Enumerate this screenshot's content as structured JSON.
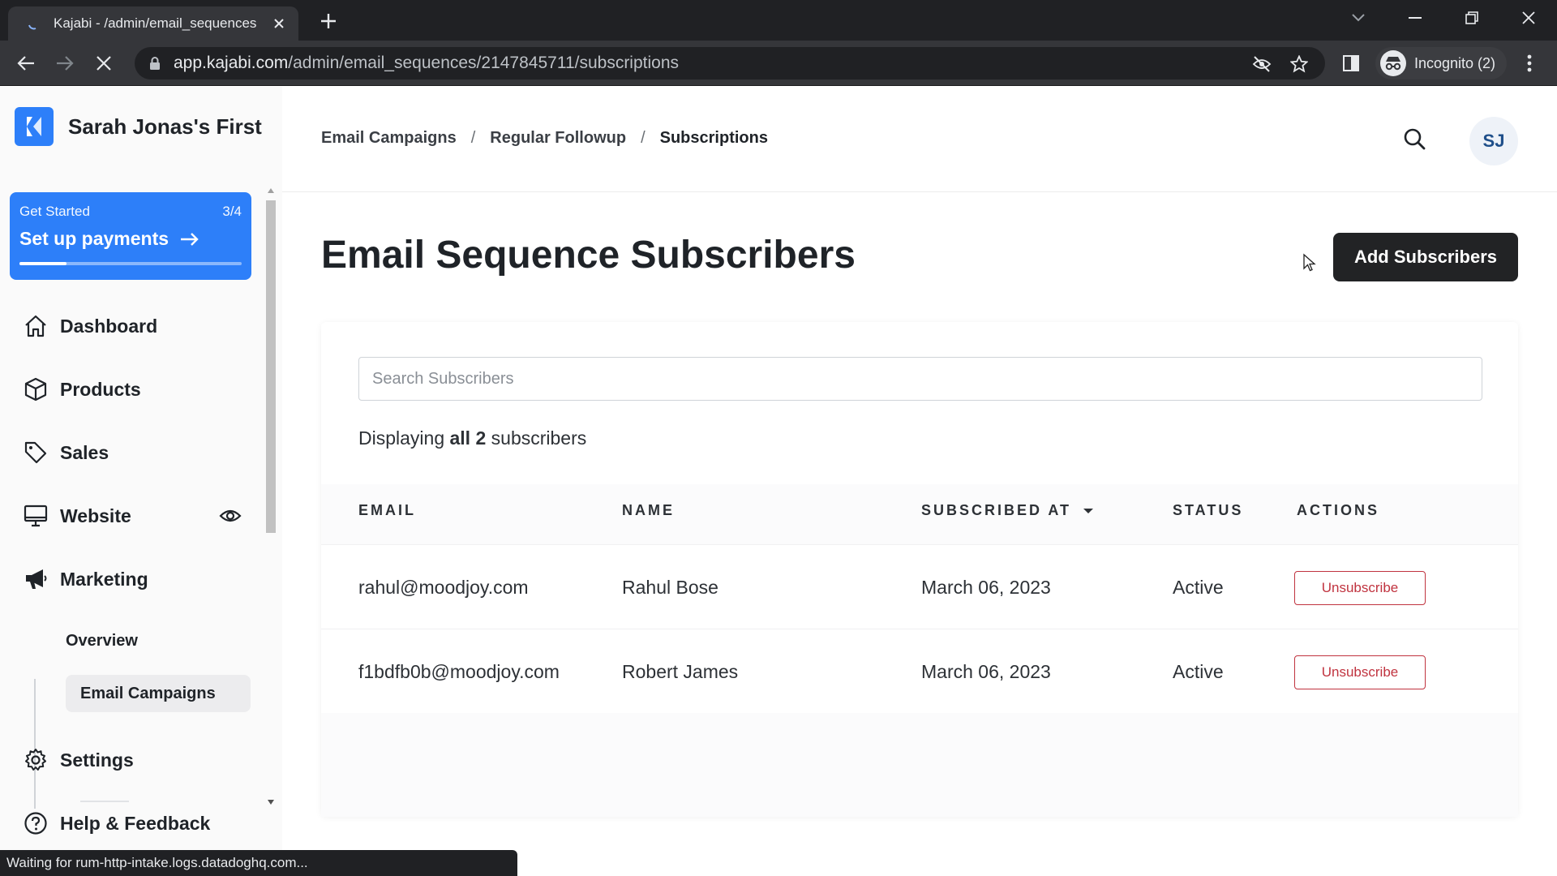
{
  "browser": {
    "tab_title": "Kajabi - /admin/email_sequences",
    "url_host": "app.kajabi.com",
    "url_path": "/admin/email_sequences/2147845711/subscriptions",
    "profile_label": "Incognito (2)",
    "status_text": "Waiting for rum-http-intake.logs.datadoghq.com..."
  },
  "sidebar": {
    "site_name": "Sarah Jonas's First",
    "get_started": {
      "label": "Get Started",
      "step": "3/4",
      "title": "Set up payments",
      "progress": 0.21
    },
    "items": [
      {
        "label": "Dashboard",
        "icon": "home-icon"
      },
      {
        "label": "Products",
        "icon": "box-icon"
      },
      {
        "label": "Sales",
        "icon": "tag-icon"
      },
      {
        "label": "Website",
        "icon": "monitor-icon"
      },
      {
        "label": "Marketing",
        "icon": "megaphone-icon"
      }
    ],
    "marketing_sub": [
      {
        "label": "Overview"
      },
      {
        "label": "Email Campaigns"
      }
    ],
    "bottom_items": [
      {
        "label": "Settings",
        "icon": "gear-icon"
      },
      {
        "label": "Help & Feedback",
        "icon": "help-icon"
      }
    ]
  },
  "header": {
    "breadcrumb": [
      "Email Campaigns",
      "Regular Followup",
      "Subscriptions"
    ],
    "avatar_initials": "SJ"
  },
  "main": {
    "title": "Email Sequence Subscribers",
    "add_button": "Add Subscribers",
    "search_placeholder": "Search Subscribers",
    "count_prefix": "Displaying",
    "count_bold": "all 2",
    "count_suffix": "subscribers",
    "columns": [
      "EMAIL",
      "NAME",
      "SUBSCRIBED AT",
      "STATUS",
      "ACTIONS"
    ],
    "rows": [
      {
        "email": "rahul@moodjoy.com",
        "name": "Rahul Bose",
        "subscribed_at": "March 06, 2023",
        "status": "Active",
        "action": "Unsubscribe"
      },
      {
        "email": "f1bdfb0b@moodjoy.com",
        "name": "Robert James",
        "subscribed_at": "March 06, 2023",
        "status": "Active",
        "action": "Unsubscribe"
      }
    ]
  },
  "colors": {
    "accent": "#2d7ff9",
    "danger": "#c0333f",
    "dark_button": "#222325"
  }
}
